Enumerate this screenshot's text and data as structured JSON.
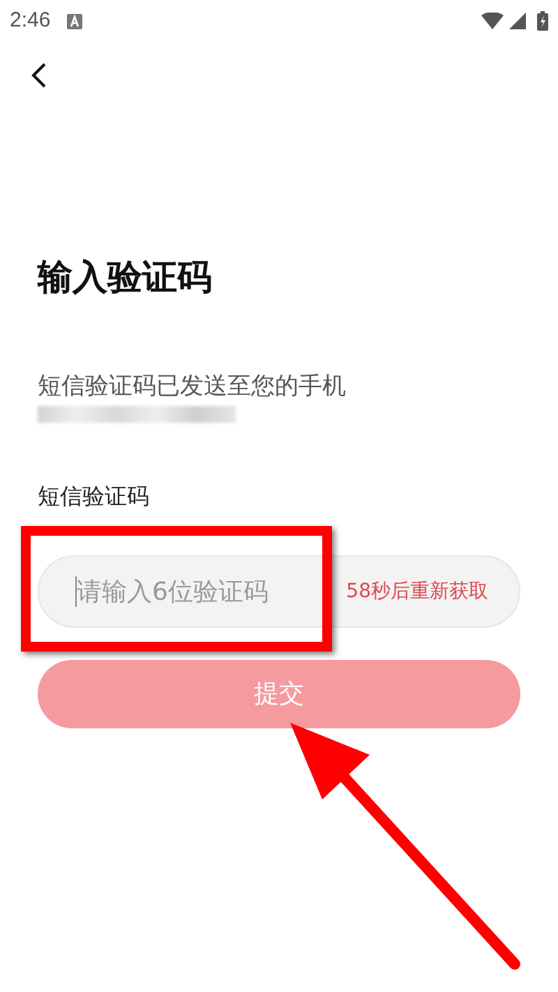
{
  "status_bar": {
    "time": "2:46"
  },
  "title": "输入验证码",
  "subtitle": "短信验证码已发送至您的手机",
  "code_label": "短信验证码",
  "code_field": {
    "placeholder": "请输入6位验证码",
    "focused": true
  },
  "resend": {
    "label": "58秒后重新获取"
  },
  "submit": {
    "label": "提交",
    "disabled": true
  }
}
